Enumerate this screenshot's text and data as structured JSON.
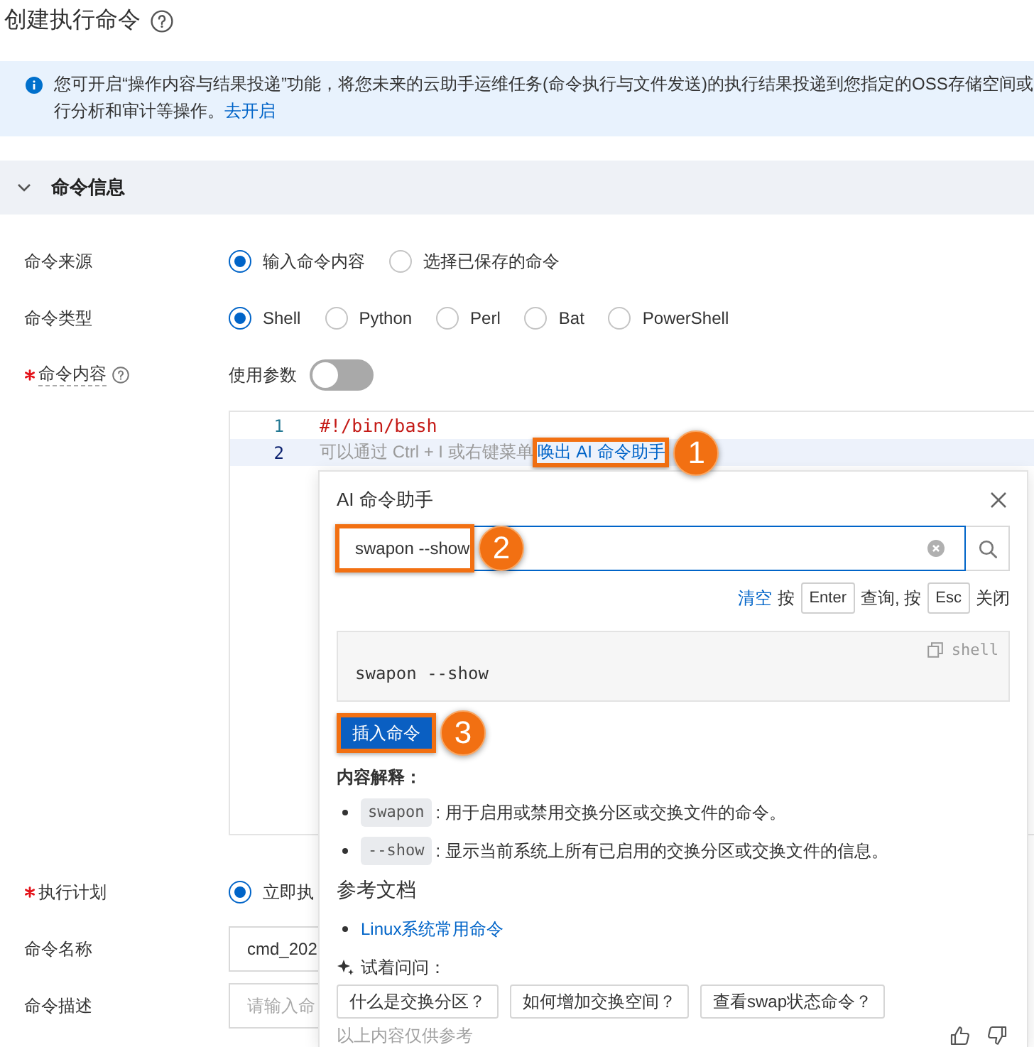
{
  "page": {
    "title": "创建执行命令"
  },
  "notice": {
    "lines": [
      "您可开启“操作内容与结果投递”功能，将您未来的云助手运维任务(命令执行与文件发送)的执行结果投递到您指定的OSS存储空间或",
      "行分析和审计等操作。"
    ],
    "link": "去开启"
  },
  "section": {
    "title": "命令信息",
    "expanded": true
  },
  "form": {
    "rows": [
      {
        "kind": "radio",
        "label": "命令来源",
        "required": false,
        "options": [
          {
            "label": "输入命令内容",
            "selected": true
          },
          {
            "label": "选择已保存的命令",
            "selected": false
          }
        ]
      },
      {
        "kind": "radio",
        "label": "命令类型",
        "required": false,
        "options": [
          {
            "label": "Shell",
            "selected": true
          },
          {
            "label": "Python",
            "selected": false
          },
          {
            "label": "Perl",
            "selected": false
          },
          {
            "label": "Bat",
            "selected": false
          },
          {
            "label": "PowerShell",
            "selected": false
          }
        ]
      },
      {
        "kind": "content",
        "label": "命令内容",
        "required": true,
        "param_toggle": {
          "label": "使用参数",
          "on": false
        },
        "editor": {
          "lines": [
            {
              "number": "1",
              "kind": "code",
              "text": "#!/bin/bash",
              "active": false
            },
            {
              "number": "2",
              "kind": "hint",
              "text": "可以通过 Ctrl + I 或右键菜单",
              "link": "唤出 AI 命令助手",
              "callout": "1",
              "active": true
            }
          ]
        }
      },
      {
        "kind": "radio",
        "label": "执行计划",
        "required": true,
        "options": [
          {
            "label": "立即执",
            "selected": true
          }
        ]
      },
      {
        "kind": "text_input",
        "label": "命令名称",
        "required": false,
        "value": "cmd_202"
      },
      {
        "kind": "text_input",
        "label": "命令描述",
        "required": false,
        "placeholder": "请输入命"
      }
    ]
  },
  "assistant": {
    "title": "AI 命令助手",
    "search": {
      "value": "swapon --show",
      "callout": "2"
    },
    "hint": [
      {
        "kind": "link",
        "text": "清空"
      },
      {
        "kind": "text",
        "text": "按"
      },
      {
        "kind": "key",
        "text": "Enter"
      },
      {
        "kind": "text",
        "text": "查询, 按"
      },
      {
        "kind": "key",
        "text": "Esc"
      },
      {
        "kind": "text",
        "text": "关闭"
      }
    ],
    "result": {
      "language": "shell",
      "code": "swapon --show"
    },
    "insert": {
      "label": "插入命令",
      "callout": "3"
    },
    "explanation": {
      "title": "内容解释：",
      "items": [
        {
          "term": "swapon",
          "text": ": 用于启用或禁用交换分区或交换文件的命令。"
        },
        {
          "term": "--show",
          "text": ": 显示当前系统上所有已启用的交换分区或交换文件的信息。"
        }
      ]
    },
    "references": {
      "title": "参考文档",
      "links": [
        "Linux系统常用命令"
      ]
    },
    "suggestions": {
      "title": "试着问问：",
      "questions": [
        "什么是交换分区？",
        "如何增加交换空间？",
        "查看swap状态命令？"
      ]
    },
    "disclaimer": "以上内容仅供参考"
  }
}
